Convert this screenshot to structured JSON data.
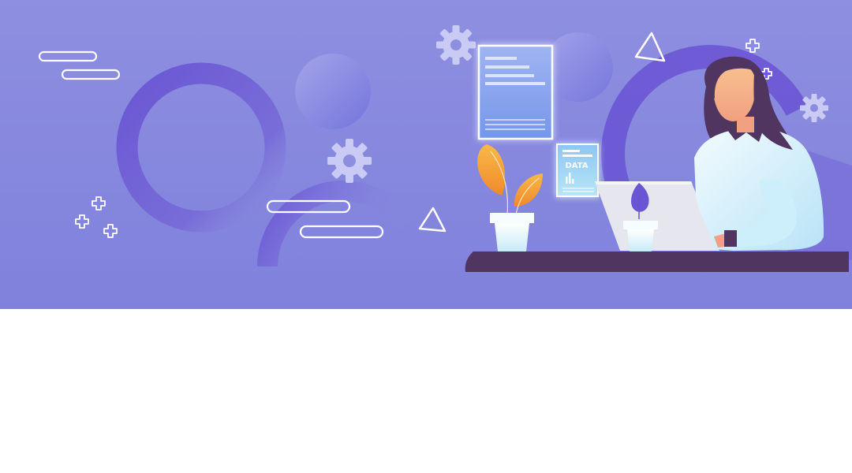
{
  "colors": {
    "background_top": "#8d8ee0",
    "background_bottom": "#8082dd",
    "accent_purple": "#6a55d4",
    "desk": "#4f3560",
    "hair": "#4f3560",
    "skin": "#f5b08a",
    "shirt": "#dff3fb",
    "leaf_orange": "#f5a742",
    "pot": "#e8f7fd",
    "laptop": "#e7e7ee",
    "panel_blue": "#86a3ee"
  },
  "illustration": {
    "data_card_label": "DATA",
    "icons": [
      "gear-icon",
      "gear-icon",
      "gear-icon",
      "plus-icon",
      "triangle-icon",
      "pill-outline"
    ]
  }
}
